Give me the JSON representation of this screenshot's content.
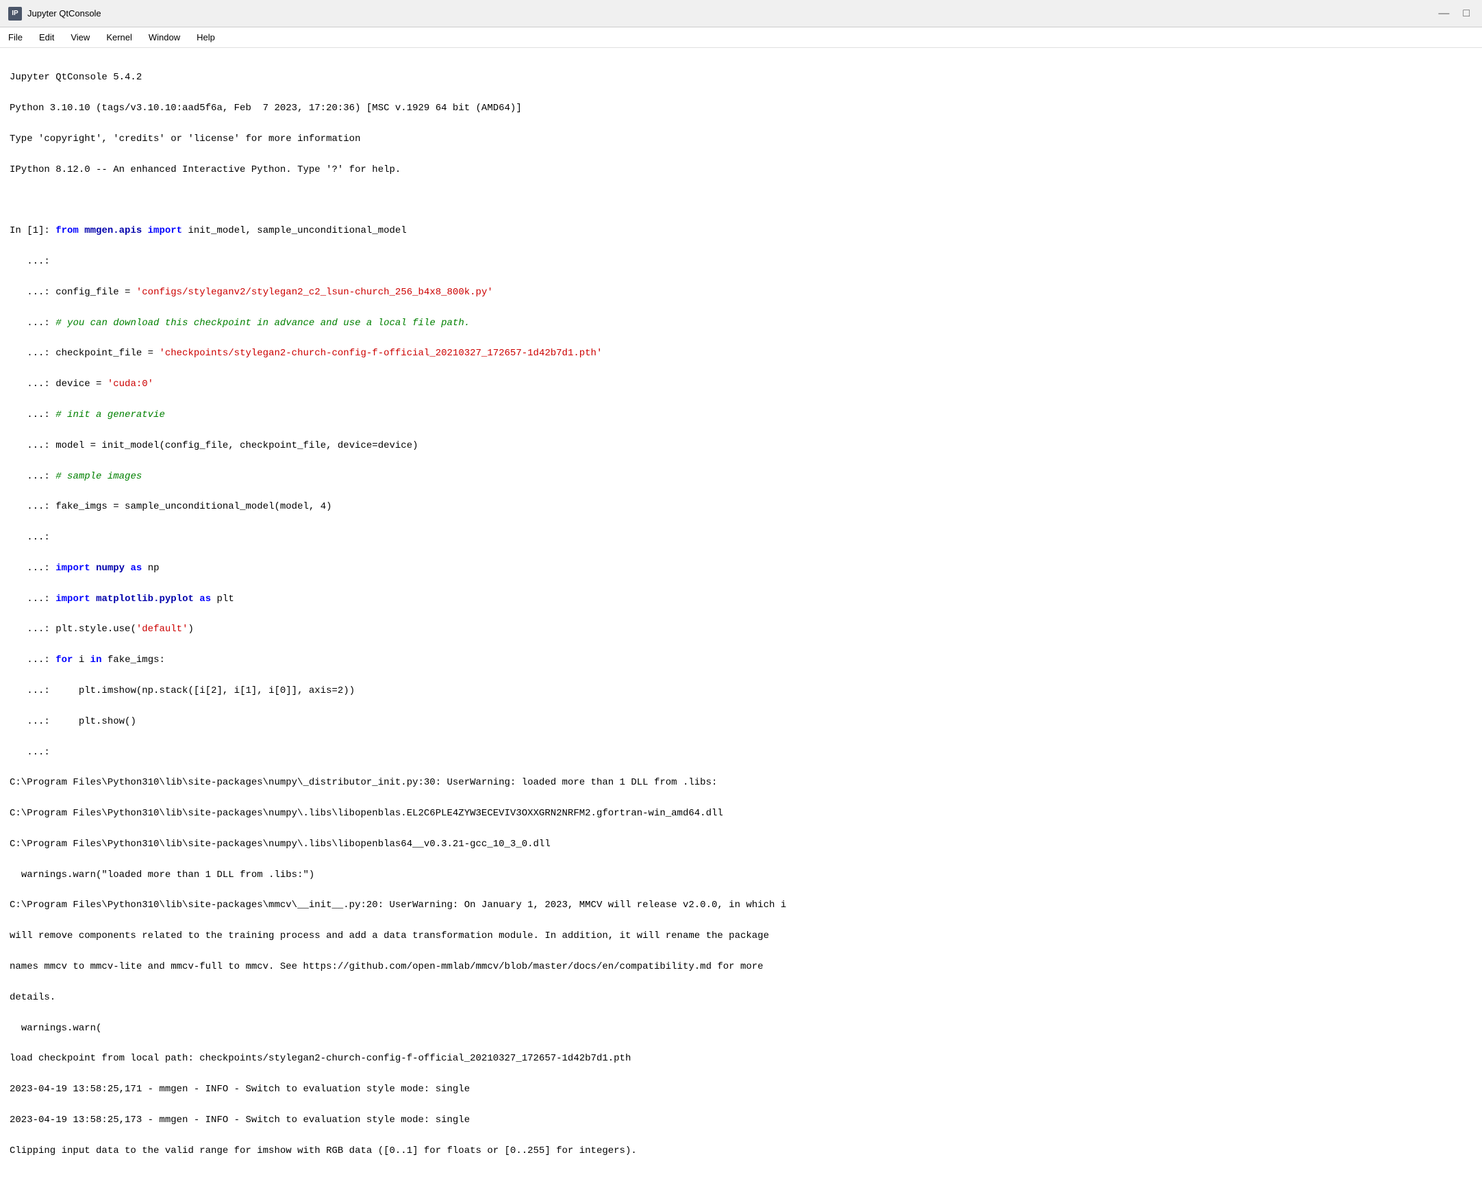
{
  "titlebar": {
    "icon_label": "IP",
    "title": "Jupyter QtConsole",
    "minimize_label": "—",
    "maximize_label": "□"
  },
  "menubar": {
    "items": [
      "File",
      "Edit",
      "View",
      "Kernel",
      "Window",
      "Help"
    ]
  },
  "console": {
    "startup_lines": [
      "Jupyter QtConsole 5.4.2",
      "Python 3.10.10 (tags/v3.10.10:aad5f6a, Feb  7 2023, 17:20:36) [MSC v.1929 64 bit (AMD64)]",
      "Type 'copyright', 'credits' or 'license' for more information",
      "IPython 8.12.0 -- An enhanced Interactive Python. Type '?' for help."
    ]
  }
}
